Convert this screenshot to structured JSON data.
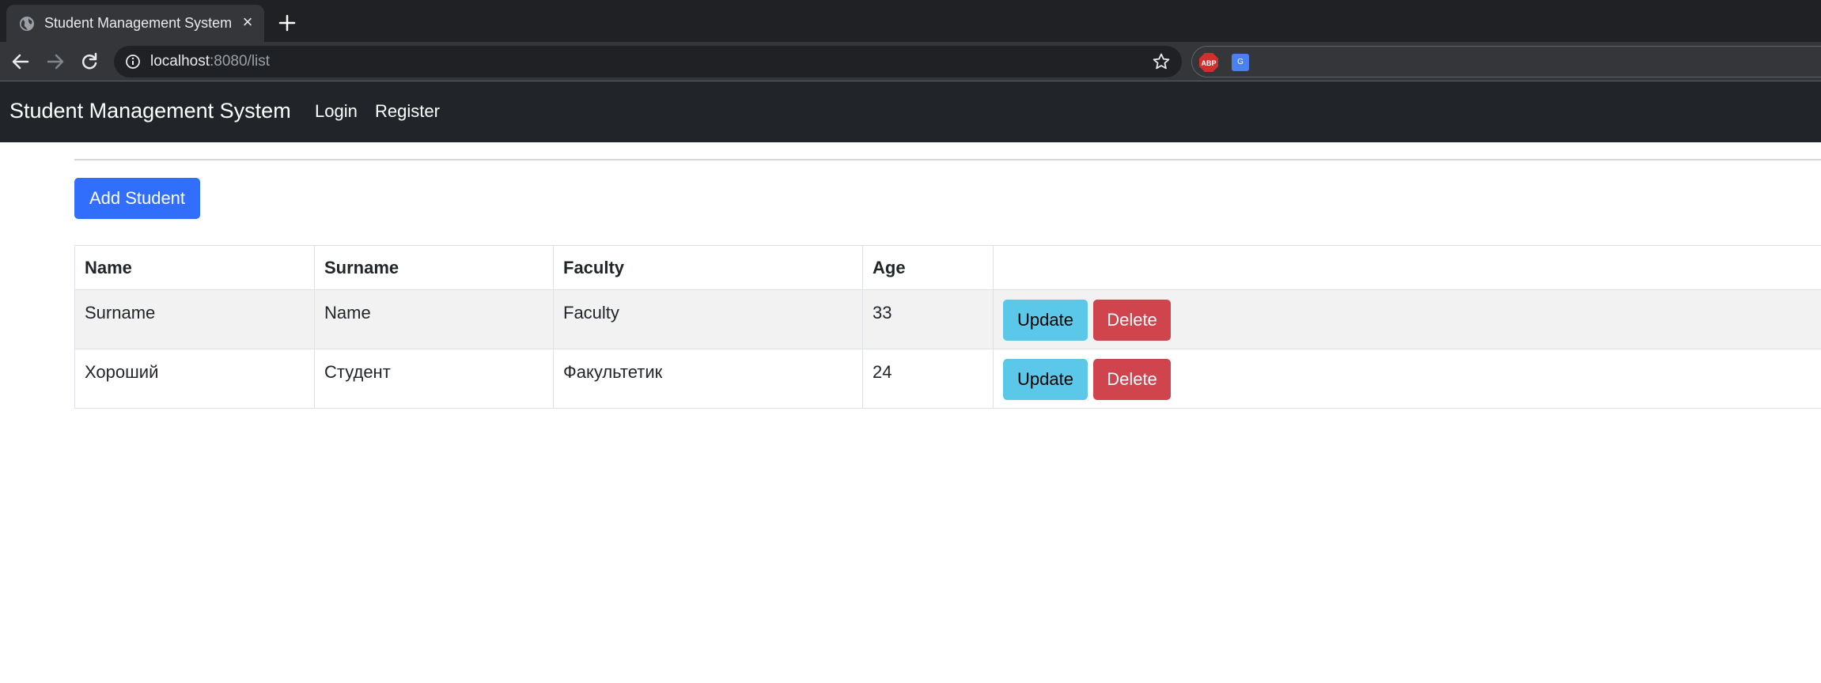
{
  "browser": {
    "tab_title": "Student Management System",
    "tab_close": "×",
    "url_host": "localhost",
    "url_rest": ":8080/list",
    "extensions": [
      "abp-icon",
      "extension-icon"
    ],
    "ext2_label": "G"
  },
  "navbar": {
    "brand": "Student Management System",
    "links": [
      "Login",
      "Register"
    ]
  },
  "actions": {
    "add_student": "Add Student"
  },
  "table": {
    "headers": [
      "Name",
      "Surname",
      "Faculty",
      "Age",
      ""
    ],
    "rows": [
      {
        "name": "Surname",
        "surname": "Name",
        "faculty": "Faculty",
        "age": "33",
        "update": "Update",
        "delete": "Delete"
      },
      {
        "name": "Хороший",
        "surname": "Студент",
        "faculty": "Факультетик",
        "age": "24",
        "update": "Update",
        "delete": "Delete"
      }
    ]
  },
  "colors": {
    "primary": "#316efb",
    "info": "#5bc8e9",
    "danger": "#d0444e",
    "navbar": "#212529"
  }
}
